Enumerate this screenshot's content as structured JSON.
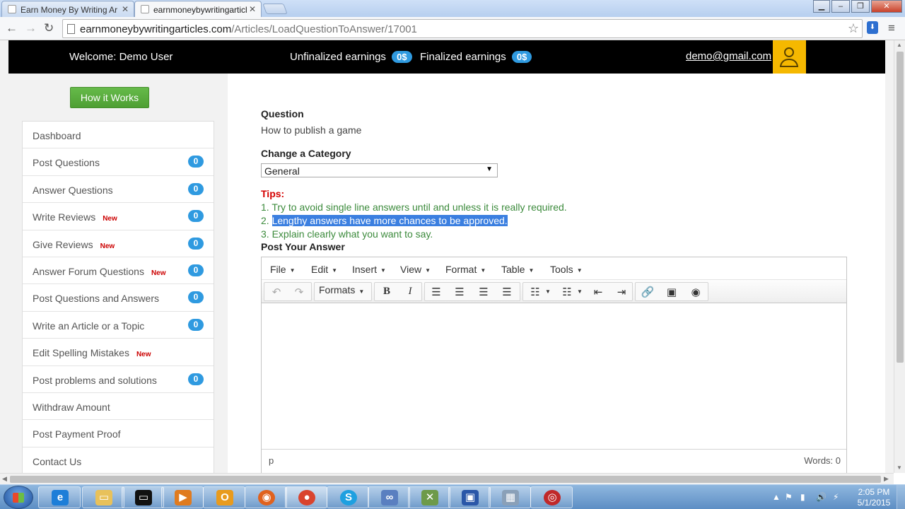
{
  "browser": {
    "tabs": [
      {
        "label": "Earn Money By Writing Ar"
      },
      {
        "label": "earnmoneybywritingarticl"
      }
    ],
    "url_domain": "earnmoneybywritingarticles.com",
    "url_path": "/Articles/LoadQuestionToAnswer/17001"
  },
  "header": {
    "welcome": "Welcome: Demo User",
    "unfinalized_label": "Unfinalized earnings",
    "unfinalized_value": "0$",
    "finalized_label": "Finalized earnings",
    "finalized_value": "0$",
    "email": "demo@gmail.com"
  },
  "sidebar": {
    "how_it_works": "How it Works",
    "items": [
      {
        "label": "Dashboard",
        "count": "",
        "new": ""
      },
      {
        "label": "Post Questions",
        "count": "0",
        "new": ""
      },
      {
        "label": "Answer Questions",
        "count": "0",
        "new": ""
      },
      {
        "label": "Write Reviews",
        "count": "0",
        "new": "New"
      },
      {
        "label": "Give Reviews",
        "count": "0",
        "new": "New"
      },
      {
        "label": "Answer Forum Questions",
        "count": "0",
        "new": "New"
      },
      {
        "label": "Post Questions and Answers",
        "count": "0",
        "new": ""
      },
      {
        "label": "Write an Article or a Topic",
        "count": "0",
        "new": ""
      },
      {
        "label": "Edit Spelling Mistakes",
        "count": "",
        "new": "New"
      },
      {
        "label": "Post problems and solutions",
        "count": "0",
        "new": ""
      },
      {
        "label": "Withdraw Amount",
        "count": "",
        "new": ""
      },
      {
        "label": "Post Payment Proof",
        "count": "",
        "new": ""
      },
      {
        "label": "Contact Us",
        "count": "",
        "new": ""
      }
    ]
  },
  "main": {
    "question_label": "Question",
    "question_text": "How to publish a game",
    "category_label": "Change a Category",
    "category_value": "General",
    "tips_label": "Tips:",
    "tips": [
      {
        "num": "1.",
        "text": "Try to avoid single line answers until and unless it is really required."
      },
      {
        "num": "2.",
        "text": "Lengthy answers have more chances to be approved."
      },
      {
        "num": "3.",
        "text": "Explain clearly what you want to say."
      }
    ],
    "post_answer_label": "Post Your Answer"
  },
  "editor": {
    "menus": [
      "File",
      "Edit",
      "Insert",
      "View",
      "Format",
      "Table",
      "Tools"
    ],
    "formats_label": "Formats",
    "status_path": "p",
    "word_count": "Words: 0"
  },
  "taskbar": {
    "time": "2:05 PM",
    "date": "5/1/2015"
  },
  "colors": {
    "accent_blue": "#2f9ae0",
    "green_button": "#5aad3e",
    "tips_red": "#d40000",
    "tips_green": "#3b8a3b",
    "avatar_yellow": "#f5b800"
  }
}
